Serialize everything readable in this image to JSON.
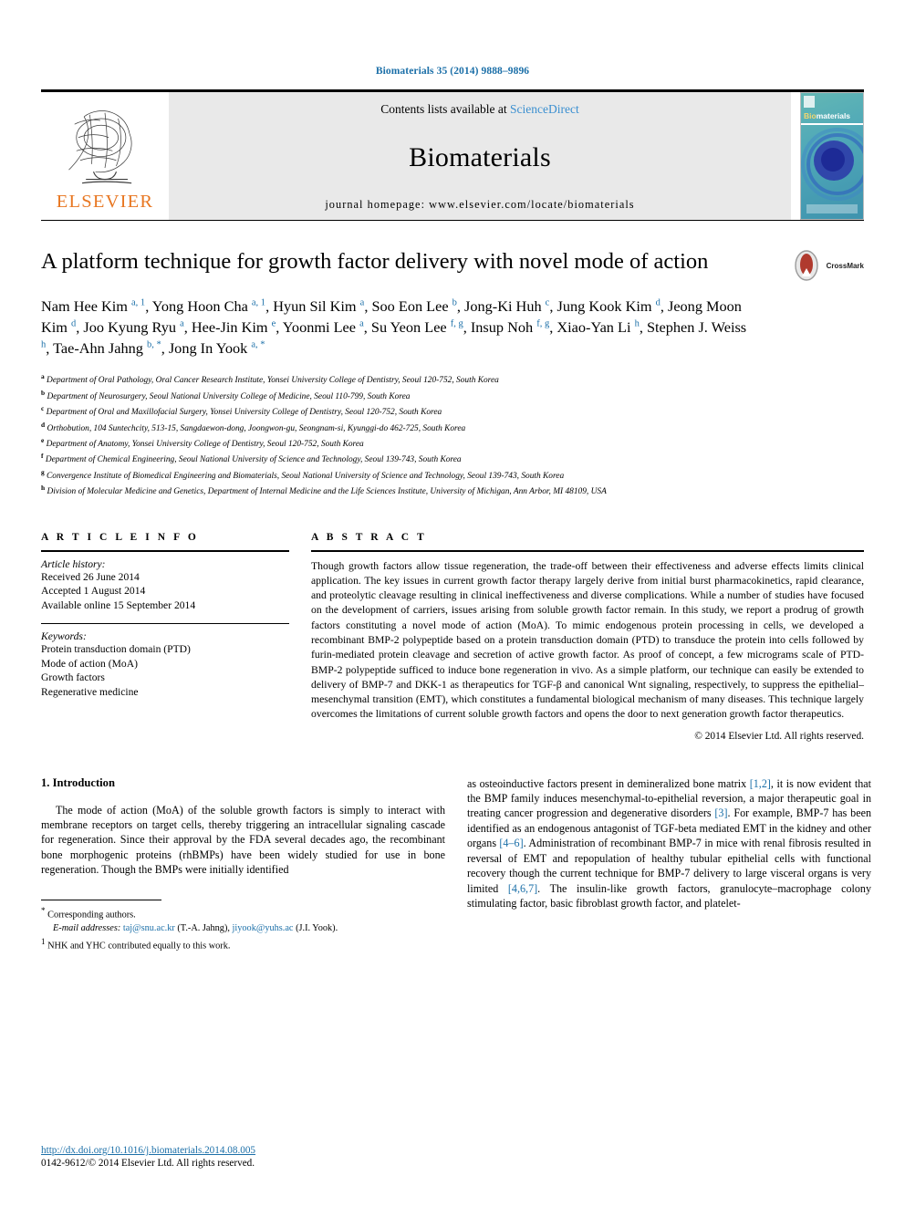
{
  "running_head": "Biomaterials 35 (2014) 9888–9896",
  "masthead": {
    "contents_prefix": "Contents lists available at ",
    "sciencedirect": "ScienceDirect",
    "journal_name": "Biomaterials",
    "homepage": "journal homepage: www.elsevier.com/locate/biomaterials",
    "publisher_wordmark": "ELSEVIER",
    "cover_title_a": "Bio",
    "cover_title_b": "materials",
    "accent_link_color": "#3a8fd0",
    "publisher_orange": "#E87722"
  },
  "article": {
    "title": "A platform technique for growth factor delivery with novel mode of action",
    "crossmark_label": "CrossMark",
    "authors_html": "Nam Hee Kim <sup>a, 1</sup>, Yong Hoon Cha <sup>a, 1</sup>, Hyun Sil Kim <sup>a</sup>, Soo Eon Lee <sup>b</sup>, Jong-Ki Huh <sup>c</sup>, Jung Kook Kim <sup>d</sup>, Jeong Moon Kim <sup>d</sup>, Joo Kyung Ryu <sup>a</sup>, Hee-Jin Kim <sup>e</sup>, Yoonmi Lee <sup>a</sup>, Su Yeon Lee <sup>f, g</sup>, Insup Noh <sup>f, g</sup>, Xiao-Yan Li <sup>h</sup>, Stephen J. Weiss <sup>h</sup>, Tae-Ahn Jahng <sup>b, *</sup>, Jong In Yook <sup>a, *</sup>",
    "affiliations": [
      {
        "marker": "a",
        "text": "Department of Oral Pathology, Oral Cancer Research Institute, Yonsei University College of Dentistry, Seoul 120-752, South Korea"
      },
      {
        "marker": "b",
        "text": "Department of Neurosurgery, Seoul National University College of Medicine, Seoul 110-799, South Korea"
      },
      {
        "marker": "c",
        "text": "Department of Oral and Maxillofacial Surgery, Yonsei University College of Dentistry, Seoul 120-752, South Korea"
      },
      {
        "marker": "d",
        "text": "Orthobution, 104 Suntechcity, 513-15, Sangdaewon-dong, Joongwon-gu, Seongnam-si, Kyunggi-do 462-725, South Korea"
      },
      {
        "marker": "e",
        "text": "Department of Anatomy, Yonsei University College of Dentistry, Seoul 120-752, South Korea"
      },
      {
        "marker": "f",
        "text": "Department of Chemical Engineering, Seoul National University of Science and Technology, Seoul 139-743, South Korea"
      },
      {
        "marker": "g",
        "text": "Convergence Institute of Biomedical Engineering and Biomaterials, Seoul National University of Science and Technology, Seoul 139-743, South Korea"
      },
      {
        "marker": "h",
        "text": "Division of Molecular Medicine and Genetics, Department of Internal Medicine and the Life Sciences Institute, University of Michigan, Ann Arbor, MI 48109, USA"
      }
    ]
  },
  "article_info": {
    "heading": "A R T I C L E  I N F O",
    "history_label": "Article history:",
    "history": [
      "Received 26 June 2014",
      "Accepted 1 August 2014",
      "Available online 15 September 2014"
    ],
    "keywords_label": "Keywords:",
    "keywords": [
      "Protein transduction domain (PTD)",
      "Mode of action (MoA)",
      "Growth factors",
      "Regenerative medicine"
    ]
  },
  "abstract": {
    "heading": "A B S T R A C T",
    "text": "Though growth factors allow tissue regeneration, the trade-off between their effectiveness and adverse effects limits clinical application. The key issues in current growth factor therapy largely derive from initial burst pharmacokinetics, rapid clearance, and proteolytic cleavage resulting in clinical ineffectiveness and diverse complications. While a number of studies have focused on the development of carriers, issues arising from soluble growth factor remain. In this study, we report a prodrug of growth factors constituting a novel mode of action (MoA). To mimic endogenous protein processing in cells, we developed a recombinant BMP-2 polypeptide based on a protein transduction domain (PTD) to transduce the protein into cells followed by furin-mediated protein cleavage and secretion of active growth factor. As proof of concept, a few micrograms scale of PTD-BMP-2 polypeptide sufficed to induce bone regeneration in vivo. As a simple platform, our technique can easily be extended to delivery of BMP-7 and DKK-1 as therapeutics for TGF-β and canonical Wnt signaling, respectively, to suppress the epithelial–mesenchymal transition (EMT), which constitutes a fundamental biological mechanism of many diseases. This technique largely overcomes the limitations of current soluble growth factors and opens the door to next generation growth factor therapeutics.",
    "copyright": "© 2014 Elsevier Ltd. All rights reserved."
  },
  "body": {
    "section_number_title": "1. Introduction",
    "left_paragraph_html": "<span class=\"indent\"></span>The mode of action (MoA) of the soluble growth factors is simply to interact with membrane receptors on target cells, thereby triggering an intracellular signaling cascade for regeneration. Since their approval by the FDA several decades ago, the recombinant bone morphogenic proteins (rhBMPs) have been widely studied for use in bone regeneration. Though the BMPs were initially identified",
    "right_paragraph_html": "as osteoinductive factors present in demineralized bone matrix <span class=\"ref\">[1,2]</span>, it is now evident that the BMP family induces mesenchymal-to-epithelial reversion, a major therapeutic goal in treating cancer progression and degenerative disorders <span class=\"ref\">[3]</span>. For example, BMP-7 has been identified as an endogenous antagonist of TGF-beta mediated EMT in the kidney and other organs <span class=\"ref\">[4–6]</span>. Administration of recombinant BMP-7 in mice with renal fibrosis resulted in reversal of EMT and repopulation of healthy tubular epithelial cells with functional recovery though the current technique for BMP-7 delivery to large visceral organs is very limited <span class=\"ref\">[4,6,7]</span>. The insulin-like growth factors, granulocyte–macrophage colony stimulating factor, basic fibroblast growth factor, and platelet-"
  },
  "footnotes": {
    "corresponding": "Corresponding authors.",
    "email_label": "E-mail addresses:",
    "email1": "taj@snu.ac.kr",
    "email1_owner": "(T.-A. Jahng),",
    "email2": "jiyook@yuhs.ac",
    "email2_owner": "(J.I. Yook).",
    "equal_contrib_marker": "1",
    "equal_contrib": "NHK and YHC contributed equally to this work."
  },
  "footer": {
    "doi": "http://dx.doi.org/10.1016/j.biomaterials.2014.08.005",
    "issn_copyright": "0142-9612/© 2014 Elsevier Ltd. All rights reserved."
  }
}
